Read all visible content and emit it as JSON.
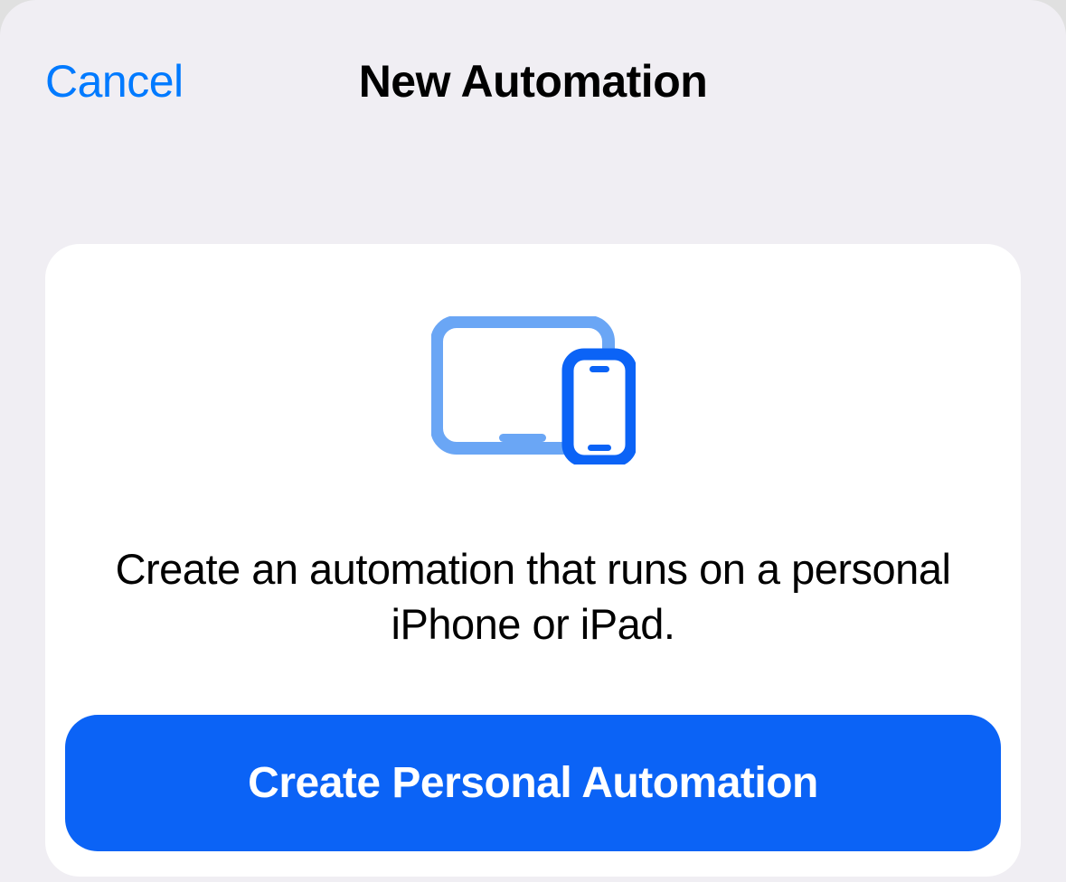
{
  "header": {
    "cancel_label": "Cancel",
    "title": "New Automation"
  },
  "card": {
    "description": "Create an automation that runs on a personal iPhone or iPad.",
    "button_label": "Create Personal Automation"
  }
}
